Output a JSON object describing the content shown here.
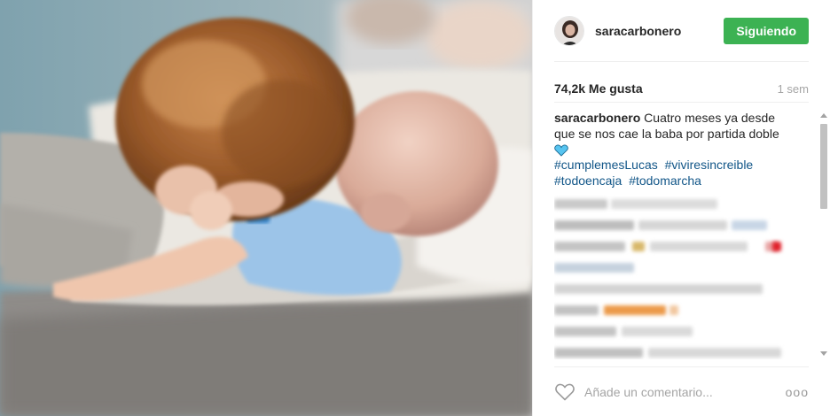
{
  "post": {
    "photo_alt": "",
    "author": {
      "username": "saracarbonero",
      "avatar_icon": "avatar-portrait"
    },
    "follow_button_label": "Siguiendo",
    "likes_text": "74,2k Me gusta",
    "time_ago": "1 sem",
    "caption": {
      "username": "saracarbonero",
      "text": "Cuatro meses ya desde que se nos cae la baba por partida doble",
      "emoji_icon": "blue-heart-icon",
      "hashtags": [
        "#cumplemesLucas",
        "#viviresincreible",
        "#todoencaja",
        "#todomarcha"
      ]
    },
    "comment_placeholder": "Añade un comentario...",
    "more_icon_label": "ooo"
  },
  "colors": {
    "follow_green": "#3cb253",
    "hashtag_blue": "#125688",
    "muted_gray": "#a5a5a5"
  }
}
